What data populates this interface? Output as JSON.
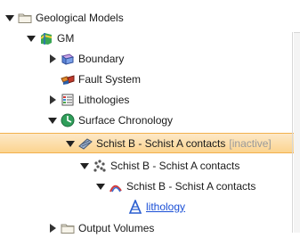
{
  "tree": {
    "items": [
      {
        "label": "Geological Models",
        "icon": "folder-icon",
        "expanded": true
      },
      {
        "label": "GM",
        "icon": "geological-model-icon",
        "expanded": true
      },
      {
        "label": "Boundary",
        "icon": "boundary-icon",
        "expanded": false
      },
      {
        "label": "Fault System",
        "icon": "fault-system-icon"
      },
      {
        "label": "Lithologies",
        "icon": "lithologies-icon",
        "expanded": false
      },
      {
        "label": "Surface Chronology",
        "icon": "surface-chronology-icon",
        "expanded": true
      },
      {
        "label": "Schist B - Schist A contacts",
        "suffix": "[inactive]",
        "icon": "contact-surface-icon",
        "expanded": true,
        "selected": true
      },
      {
        "label": "Schist B - Schist A contacts",
        "icon": "contact-points-icon",
        "expanded": true
      },
      {
        "label": "Schist B - Schist A contacts",
        "icon": "contact-lines-icon",
        "expanded": true
      },
      {
        "label": "lithology",
        "icon": "lithology-icon"
      },
      {
        "label": "Output Volumes",
        "icon": "folder-icon",
        "expanded": false
      }
    ]
  },
  "colors": {
    "selection_fill": "#fbd48f",
    "selection_border": "#f2b14d",
    "link": "#1a4fd6",
    "inactive_text": "#9a9a9a"
  }
}
